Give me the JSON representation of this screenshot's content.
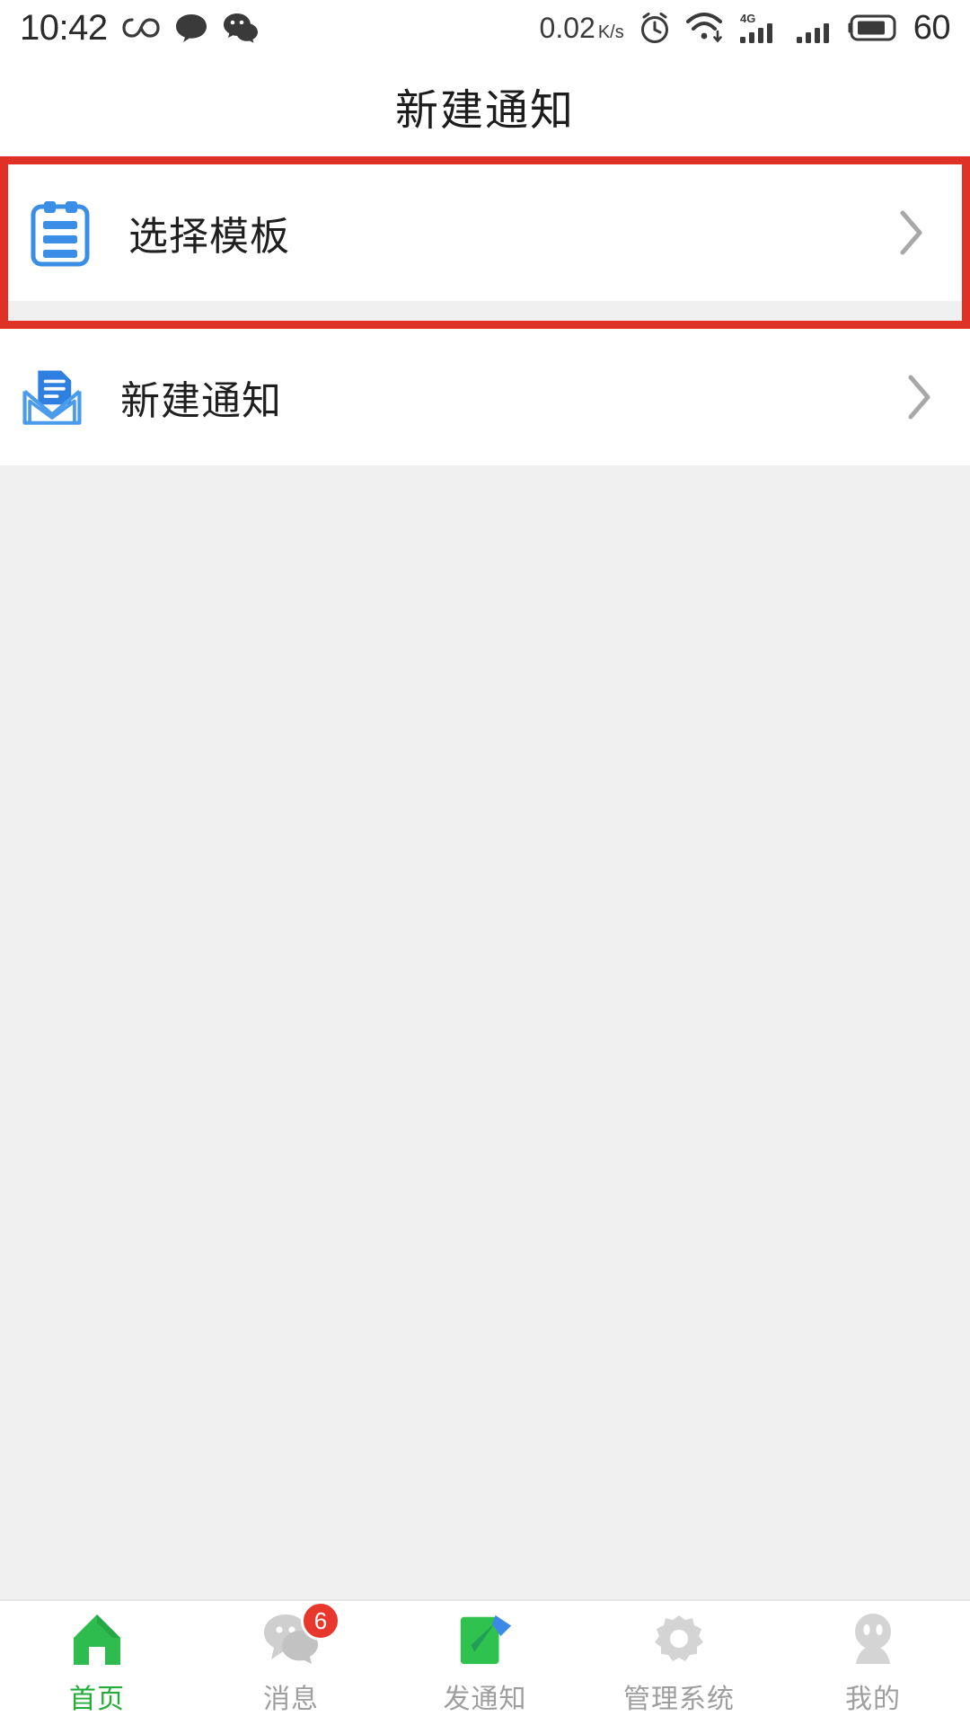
{
  "status_bar": {
    "time": "10:42",
    "left_icons": [
      "infinity-icon",
      "chat-bubble-icon",
      "wechat-icon"
    ],
    "network_speed": "0.02",
    "network_unit": "K/s",
    "right_icons": [
      "alarm-clock-icon",
      "wifi-icon",
      "signal-4g-icon",
      "signal-icon",
      "battery-icon"
    ],
    "battery_percent": "60",
    "network_type": "4G"
  },
  "header": {
    "title": "新建通知"
  },
  "list": {
    "items": [
      {
        "label": "选择模板",
        "icon": "clipboard-icon",
        "highlighted": true,
        "chevron": "chevron-right-icon"
      },
      {
        "label": "新建通知",
        "icon": "envelope-document-icon",
        "highlighted": false,
        "chevron": "chevron-right-icon"
      }
    ]
  },
  "tabbar": {
    "items": [
      {
        "label": "首页",
        "icon": "home-icon",
        "active": true,
        "badge": ""
      },
      {
        "label": "消息",
        "icon": "message-icon",
        "active": false,
        "badge": "6"
      },
      {
        "label": "发通知",
        "icon": "send-notice-icon",
        "active": false,
        "badge": ""
      },
      {
        "label": "管理系统",
        "icon": "gear-icon",
        "active": false,
        "badge": ""
      },
      {
        "label": "我的",
        "icon": "person-icon",
        "active": false,
        "badge": ""
      }
    ]
  },
  "colors": {
    "highlight_red": "#e03127",
    "active_green": "#23ac38",
    "icon_blue": "#3a8ee6",
    "badge_red": "#e8372c",
    "page_bg": "#f0f0f0",
    "card_bg": "#ffffff"
  }
}
